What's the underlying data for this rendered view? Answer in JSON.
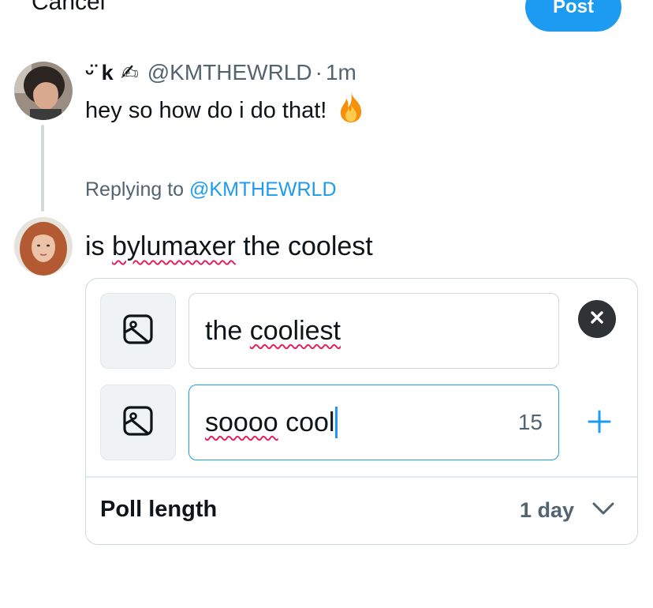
{
  "header": {
    "cancel_label": "Cancel",
    "post_label": "Post"
  },
  "parent_tweet": {
    "display_name": "ᵕ̈ k ✍︎",
    "handle": "@KMTHEWRLD",
    "separator": "·",
    "time": "1m",
    "text": "hey so how do i do that!",
    "emoji": "fire-icon"
  },
  "reply": {
    "prefix": "Replying to ",
    "mention": "@KMTHEWRLD"
  },
  "compose": {
    "before": "is ",
    "misspelled": "bylumaxer",
    "after": " the coolest"
  },
  "poll": {
    "choice1": {
      "prefix": "the ",
      "misspelled": "cooliest"
    },
    "choice2": {
      "misspelled": "soooo",
      "rest": " cool",
      "char_count": "15"
    },
    "length_label": "Poll length",
    "length_value": "1 day"
  },
  "colors": {
    "accent": "#1d9bf0",
    "text": "#0f1419",
    "muted": "#536471",
    "border": "#cfd9de",
    "spell": "#e0245e"
  }
}
